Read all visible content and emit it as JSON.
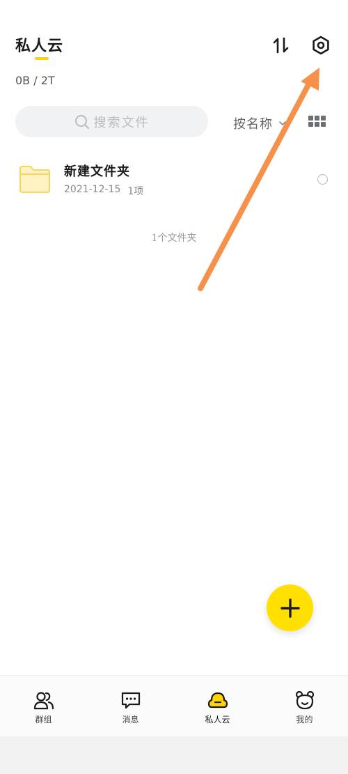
{
  "header": {
    "title": "私人云",
    "storage": "0B / 2T",
    "sort_icon": "sort-arrows-icon",
    "settings_icon": "settings-gear-icon"
  },
  "toolbar": {
    "search_placeholder": "搜索文件",
    "sort_label": "按名称",
    "view_icon": "grid-view-icon"
  },
  "files": [
    {
      "name": "新建文件夹",
      "date": "2021-12-15",
      "count": "1项",
      "icon": "folder-icon"
    }
  ],
  "folder_count": "1个文件夹",
  "fab": {
    "icon": "plus-icon"
  },
  "bottom_nav": [
    {
      "label": "群组",
      "icon": "group-icon",
      "active": false
    },
    {
      "label": "消息",
      "icon": "message-icon",
      "active": false
    },
    {
      "label": "私人云",
      "icon": "cloud-icon",
      "active": true
    },
    {
      "label": "我的",
      "icon": "profile-bear-icon",
      "active": false
    }
  ],
  "colors": {
    "accent": "#ffd400",
    "fab": "#ffe000",
    "annotation_arrow": "#f5914a",
    "folder": "#fde58a"
  }
}
